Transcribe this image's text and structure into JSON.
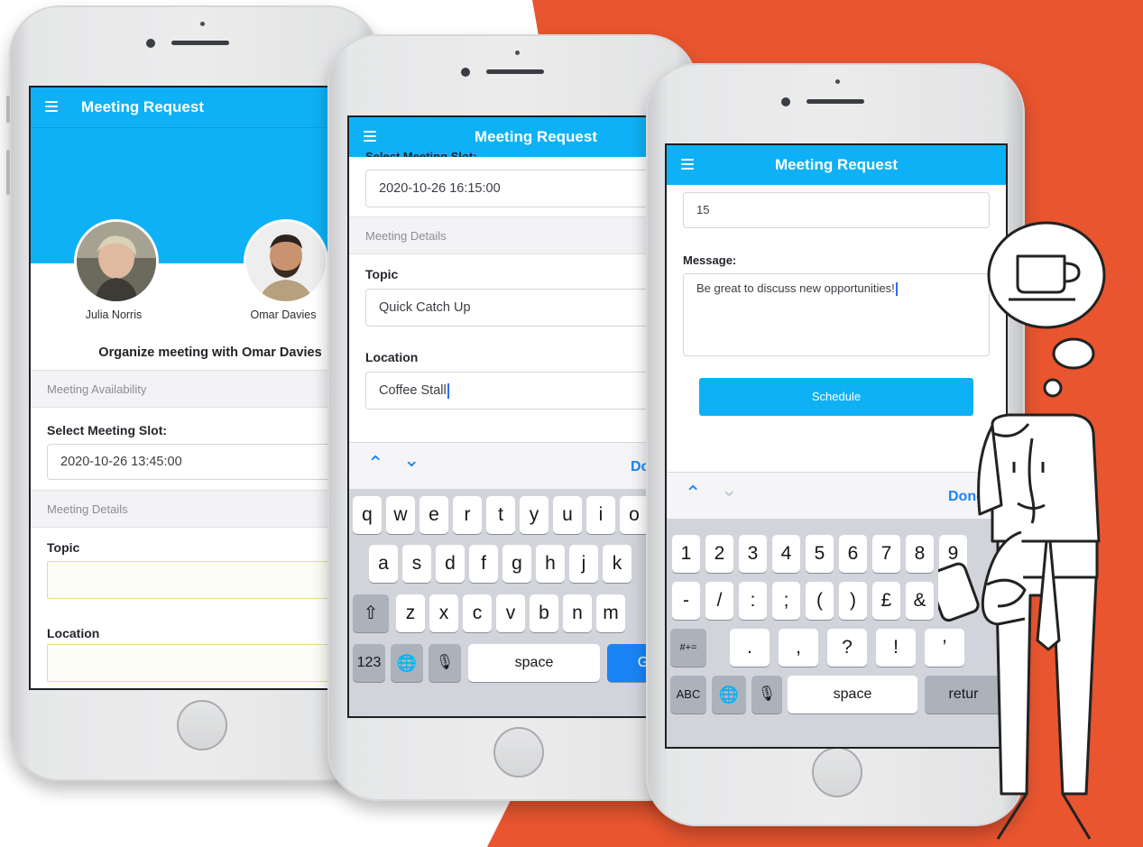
{
  "colors": {
    "accent": "#0eb1f5",
    "orange": "#e8552f",
    "ios_blue": "#1a84f6"
  },
  "phone1": {
    "title": "Meeting Request",
    "people": [
      {
        "name": "Julia Norris",
        "avatar": "avatar-woman"
      },
      {
        "name": "Omar Davies",
        "avatar": "avatar-man"
      }
    ],
    "organize_text": "Organize meeting with Omar Davies",
    "availability_header": "Meeting Availability",
    "slot_label": "Select Meeting Slot:",
    "slot_value": "2020-10-26 13:45:00",
    "details_header": "Meeting Details",
    "topic_label": "Topic",
    "topic_value": "",
    "location_label": "Location",
    "location_value": ""
  },
  "phone2": {
    "title": "Meeting Request",
    "slot_label_partial": "Select Meeting Slot:",
    "slot_value": "2020-10-26 16:15:00",
    "details_header": "Meeting Details",
    "topic_label": "Topic",
    "topic_value": "Quick Catch Up",
    "location_label": "Location",
    "location_value": "Coffee Stall",
    "done_label": "Do",
    "keyboard": {
      "row1": [
        "q",
        "w",
        "e",
        "r",
        "t",
        "y",
        "u",
        "i",
        "o"
      ],
      "row2": [
        "a",
        "s",
        "d",
        "f",
        "g",
        "h",
        "j",
        "k"
      ],
      "row3": [
        "z",
        "x",
        "c",
        "v",
        "b",
        "n",
        "m"
      ],
      "numbers_key": "123",
      "space_key": "space",
      "go_key": "G"
    }
  },
  "phone3": {
    "title": "Meeting Request",
    "duration_value": "15",
    "message_label": "Message:",
    "message_value": "Be great to discuss new opportunities!",
    "schedule_button": "Schedule",
    "done_label": "Done",
    "keyboard": {
      "row1": [
        "1",
        "2",
        "3",
        "4",
        "5",
        "6",
        "7",
        "8",
        "9"
      ],
      "row2": [
        "-",
        "/",
        ":",
        ";",
        "(",
        ")",
        "£",
        "&"
      ],
      "row3": [
        ".",
        ",",
        "?",
        "!",
        "’"
      ],
      "symbols_key": "#+=",
      "abc_key": "ABC",
      "space_key": "space",
      "return_key": "retur"
    }
  },
  "illustration": {
    "thought_icon": "coffee-cup-icon",
    "figure": "businessman-with-phone"
  }
}
